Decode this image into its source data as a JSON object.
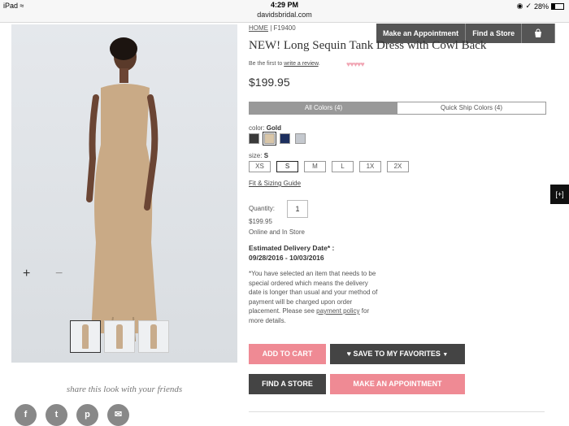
{
  "status_bar": {
    "device": "iPad",
    "time": "4:29 PM",
    "url": "davidsbridal.com",
    "battery": "28%",
    "battery_level": 0.28
  },
  "top_nav": {
    "appointment": "Make an Appointment",
    "find_store": "Find a Store",
    "bag_icon": "shopping-bag-icon"
  },
  "gallery": {
    "zoom_in": "+",
    "zoom_out": "−",
    "thumbnails": 3,
    "selected_thumbnail": 0
  },
  "share": {
    "text": "share this look with your friends",
    "icons": [
      "f",
      "t",
      "p",
      "✉"
    ]
  },
  "product": {
    "breadcrumb_home": "HOME",
    "breadcrumb_sep": "|",
    "breadcrumb_id": "F19400",
    "title": "NEW! Long Sequin Tank Dress with Cowl Back",
    "review_prefix": "Be the first to",
    "review_link": "write a review",
    "review_suffix": ".",
    "stars": "♥♥♥♥♥",
    "price": "$199.95",
    "tab_all": "All Colors (4)",
    "tab_quick": "Quick Ship Colors (4)",
    "color_label": "color:",
    "color_value": "Gold",
    "swatches": [
      "#3a3a3a",
      "#d9c6a8",
      "#1d2f5e",
      "#c4c8ce"
    ],
    "selected_swatch": 1,
    "size_label": "size:",
    "size_value": "S",
    "sizes": [
      "XS",
      "S",
      "M",
      "L",
      "1X",
      "2X"
    ],
    "selected_size": 1,
    "fit_guide": "Fit & Sizing Guide",
    "quantity_label": "Quantity:",
    "quantity": "1",
    "unit_price": "$199.95",
    "availability": "Online and In Store",
    "delivery_label": "Estimated Delivery Date* :",
    "delivery_range": "09/28/2016 - 10/03/2016",
    "note_text": "*You have selected an item that needs to be special ordered which means the delivery date is longer than usual and your method of payment will be charged upon order placement. Please see",
    "note_link": "payment policy",
    "note_suffix": "for more details."
  },
  "buttons": {
    "add_to_cart": "ADD TO CART",
    "save_favorites": "SAVE TO MY FAVORITES",
    "find_store": "FIND A STORE",
    "make_appointment": "MAKE AN APPOINTMENT"
  },
  "side_tab": "[+]"
}
